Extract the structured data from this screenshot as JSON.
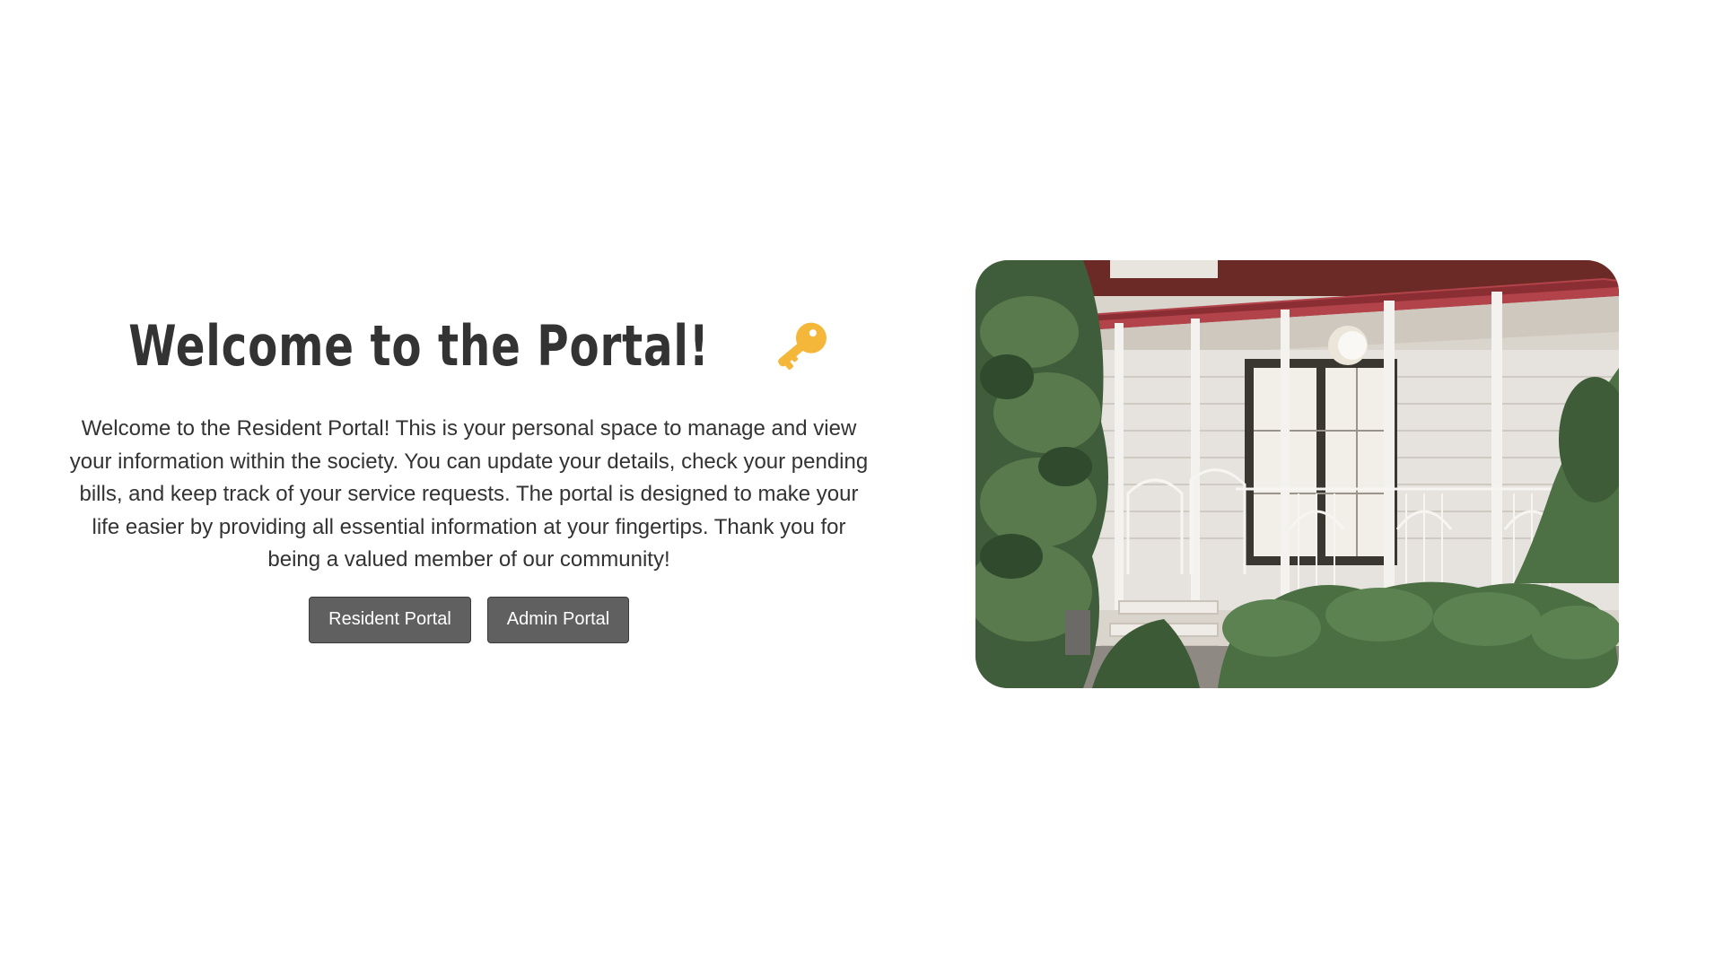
{
  "hero": {
    "title": "Welcome to the Portal!",
    "title_icon": "key-icon",
    "description": "Welcome to the Resident Portal! This is your personal space to manage and view your information within the society. You can update your details, check your pending bills, and keep track of your service requests. The portal is designed to make your life easier by providing all essential information at your fingertips. Thank you for being a valued member of our community!",
    "buttons": {
      "resident_label": "Resident Portal",
      "admin_label": "Admin Portal"
    }
  },
  "photo": {
    "subject": "house-porch-photo"
  },
  "colors": {
    "text": "#333333",
    "button_bg": "#606060",
    "key_icon": "#F4B73A"
  }
}
